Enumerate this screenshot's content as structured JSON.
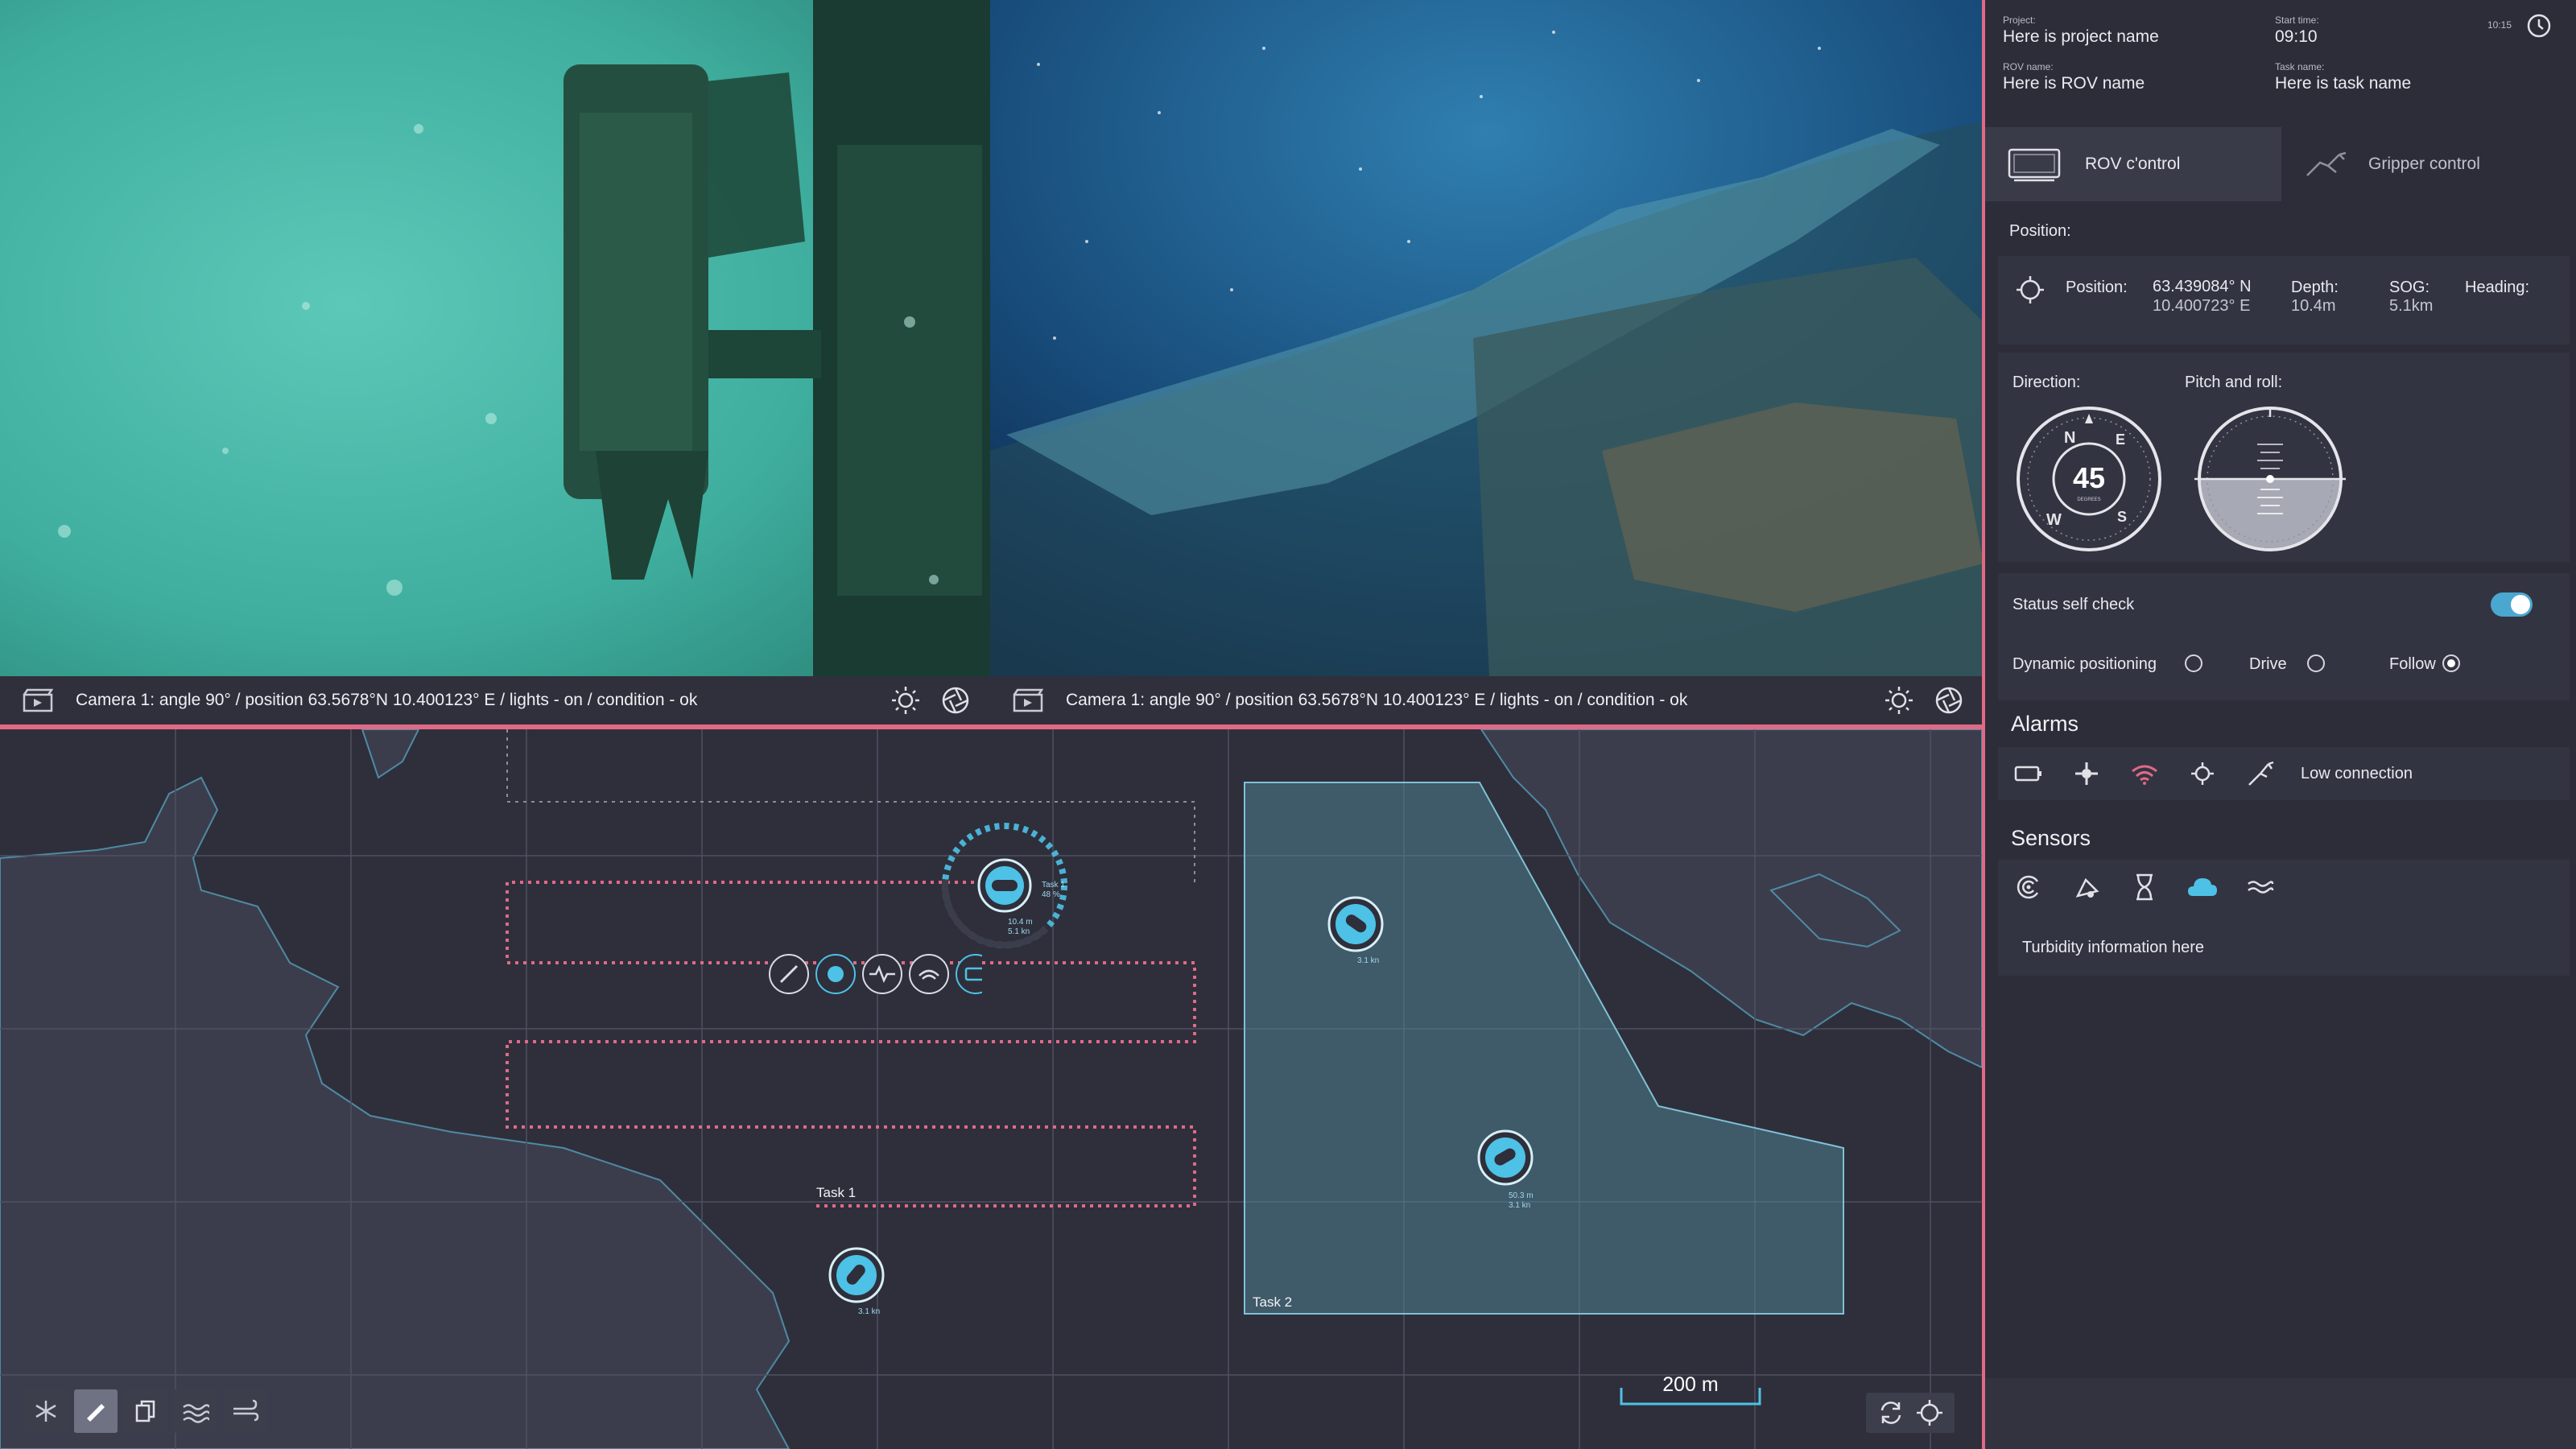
{
  "cameras": [
    {
      "caption": "Camera 1:  angle 90°  / position 63.5678°N 10.400123° E / lights - on / condition - ok"
    },
    {
      "caption": "Camera 1:  angle 90°  / position 63.5678°N 10.400123° E / lights - on / condition - ok"
    }
  ],
  "map": {
    "task1_label": "Task 1",
    "task2_label": "Task 2",
    "rov_main": {
      "task": "Task 1",
      "progress": "48 %",
      "depth": "10.4 m",
      "speed": "5.1 kn"
    },
    "rov_a": {
      "speed": "3.1 kn"
    },
    "rov_b": {
      "depth": "50.3 m",
      "speed": "3.1 kn"
    },
    "rov_c": {
      "speed": "3.1 kn"
    },
    "scale": "200 m"
  },
  "header": {
    "project_label": "Project:",
    "project_value": "Here is project name",
    "start_label": "Start time:",
    "start_value": "09:10",
    "clock": "10:15",
    "rov_label": "ROV name:",
    "rov_value": "Here is ROV name",
    "task_label": "Task name:",
    "task_value": "Here is task name"
  },
  "tabs": {
    "rov": "ROV c'ontrol",
    "gripper": "Gripper control"
  },
  "position": {
    "title": "Position:",
    "pos_label": "Position:",
    "lat": "63.439084° N",
    "lon": "10.400723° E",
    "depth_label": "Depth:",
    "depth_value": "10.4m",
    "sog_label": "SOG:",
    "sog_value": "5.1km",
    "heading_label": "Heading:"
  },
  "direction": {
    "title": "Direction:",
    "degrees": "45",
    "sub": "DEGREES",
    "n": "N",
    "e": "E",
    "s": "S",
    "w": "W"
  },
  "pitch": {
    "title": "Pitch and roll:"
  },
  "status": {
    "label": "Status self check",
    "enabled": true
  },
  "modes": {
    "dynamic": "Dynamic positioning",
    "drive": "Drive",
    "follow": "Follow",
    "selected": "follow"
  },
  "alarms": {
    "title": "Alarms",
    "message": "Low connection"
  },
  "sensors": {
    "title": "Sensors",
    "info": "Turbidity information here"
  },
  "colors": {
    "accent": "#4ec1e6",
    "alert": "#e06a86",
    "panel": "#2c2d39"
  }
}
